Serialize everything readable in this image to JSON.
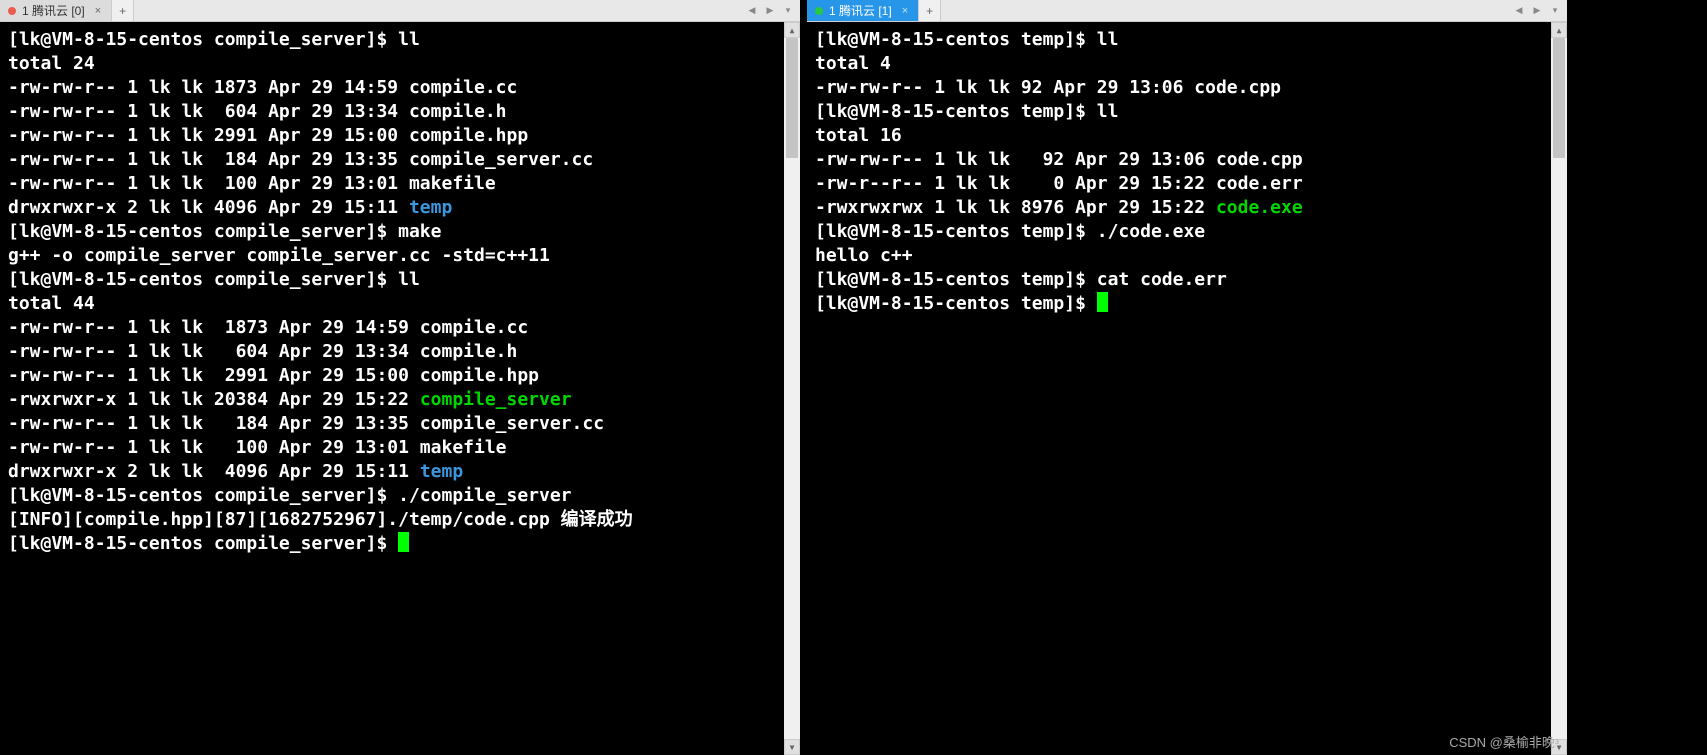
{
  "left": {
    "tab": {
      "label": "1 腾讯云 [0]",
      "dotColor": "#e85d4e"
    },
    "lines": [
      {
        "segs": [
          {
            "t": "[lk@VM-8-15-centos compile_server]$ ll"
          }
        ]
      },
      {
        "segs": [
          {
            "t": "total 24"
          }
        ]
      },
      {
        "segs": [
          {
            "t": "-rw-rw-r-- 1 lk lk 1873 Apr 29 14:59 compile.cc"
          }
        ]
      },
      {
        "segs": [
          {
            "t": "-rw-rw-r-- 1 lk lk  604 Apr 29 13:34 compile.h"
          }
        ]
      },
      {
        "segs": [
          {
            "t": "-rw-rw-r-- 1 lk lk 2991 Apr 29 15:00 compile.hpp"
          }
        ]
      },
      {
        "segs": [
          {
            "t": "-rw-rw-r-- 1 lk lk  184 Apr 29 13:35 compile_server.cc"
          }
        ]
      },
      {
        "segs": [
          {
            "t": "-rw-rw-r-- 1 lk lk  100 Apr 29 13:01 makefile"
          }
        ]
      },
      {
        "segs": [
          {
            "t": "drwxrwxr-x 2 lk lk 4096 Apr 29 15:11 "
          },
          {
            "t": "temp",
            "c": "c-blue"
          }
        ]
      },
      {
        "segs": [
          {
            "t": "[lk@VM-8-15-centos compile_server]$ make"
          }
        ]
      },
      {
        "segs": [
          {
            "t": "g++ -o compile_server compile_server.cc -std=c++11"
          }
        ]
      },
      {
        "segs": [
          {
            "t": "[lk@VM-8-15-centos compile_server]$ ll"
          }
        ]
      },
      {
        "segs": [
          {
            "t": "total 44"
          }
        ]
      },
      {
        "segs": [
          {
            "t": "-rw-rw-r-- 1 lk lk  1873 Apr 29 14:59 compile.cc"
          }
        ]
      },
      {
        "segs": [
          {
            "t": "-rw-rw-r-- 1 lk lk   604 Apr 29 13:34 compile.h"
          }
        ]
      },
      {
        "segs": [
          {
            "t": "-rw-rw-r-- 1 lk lk  2991 Apr 29 15:00 compile.hpp"
          }
        ]
      },
      {
        "segs": [
          {
            "t": "-rwxrwxr-x 1 lk lk 20384 Apr 29 15:22 "
          },
          {
            "t": "compile_server",
            "c": "c-green"
          }
        ]
      },
      {
        "segs": [
          {
            "t": "-rw-rw-r-- 1 lk lk   184 Apr 29 13:35 compile_server.cc"
          }
        ]
      },
      {
        "segs": [
          {
            "t": "-rw-rw-r-- 1 lk lk   100 Apr 29 13:01 makefile"
          }
        ]
      },
      {
        "segs": [
          {
            "t": "drwxrwxr-x 2 lk lk  4096 Apr 29 15:11 "
          },
          {
            "t": "temp",
            "c": "c-blue"
          }
        ]
      },
      {
        "segs": [
          {
            "t": "[lk@VM-8-15-centos compile_server]$ ./compile_server"
          }
        ]
      },
      {
        "segs": [
          {
            "t": "[INFO][compile.hpp][87][1682752967]./temp/code.cpp 编译成功"
          }
        ]
      },
      {
        "segs": [
          {
            "t": "[lk@VM-8-15-centos compile_server]$ "
          }
        ],
        "cursor": true
      }
    ]
  },
  "right": {
    "tab": {
      "label": "1 腾讯云 [1]",
      "dotColor": "#27c93f"
    },
    "lines": [
      {
        "segs": [
          {
            "t": "[lk@VM-8-15-centos temp]$ ll"
          }
        ]
      },
      {
        "segs": [
          {
            "t": "total 4"
          }
        ]
      },
      {
        "segs": [
          {
            "t": "-rw-rw-r-- 1 lk lk 92 Apr 29 13:06 code.cpp"
          }
        ]
      },
      {
        "segs": [
          {
            "t": "[lk@VM-8-15-centos temp]$ ll"
          }
        ]
      },
      {
        "segs": [
          {
            "t": "total 16"
          }
        ]
      },
      {
        "segs": [
          {
            "t": "-rw-rw-r-- 1 lk lk   92 Apr 29 13:06 code.cpp"
          }
        ]
      },
      {
        "segs": [
          {
            "t": "-rw-r--r-- 1 lk lk    0 Apr 29 15:22 code.err"
          }
        ]
      },
      {
        "segs": [
          {
            "t": "-rwxrwxrwx 1 lk lk 8976 Apr 29 15:22 "
          },
          {
            "t": "code.exe",
            "c": "c-green"
          }
        ]
      },
      {
        "segs": [
          {
            "t": "[lk@VM-8-15-centos temp]$ ./code.exe"
          }
        ]
      },
      {
        "segs": [
          {
            "t": "hello c++"
          }
        ]
      },
      {
        "segs": [
          {
            "t": "[lk@VM-8-15-centos temp]$ cat code.err"
          }
        ]
      },
      {
        "segs": [
          {
            "t": "[lk@VM-8-15-centos temp]$ "
          }
        ],
        "cursor": true
      }
    ]
  },
  "watermark": "CSDN @桑榆非晚ᵌ",
  "nav": {
    "left": "◀",
    "right": "▶",
    "down": "▾",
    "add": "+",
    "close": "×"
  }
}
